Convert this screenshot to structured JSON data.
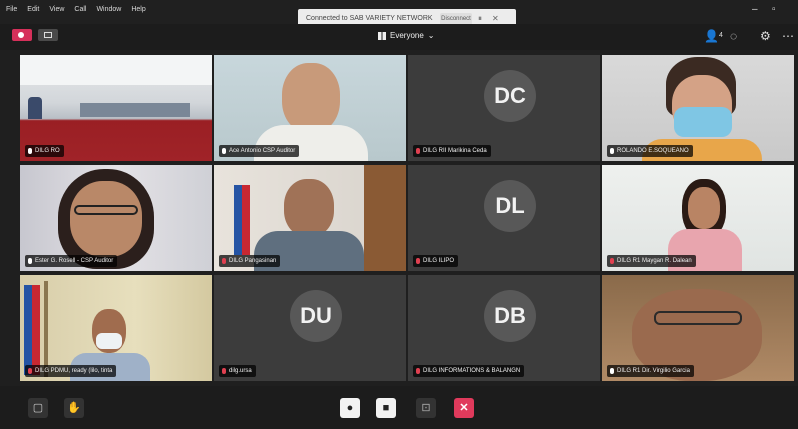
{
  "menubar": {
    "items": [
      "File",
      "Edit",
      "View",
      "Call",
      "Window",
      "Help"
    ]
  },
  "notification": {
    "text": "Connected to SAB VARIETY NETWORK",
    "button": "Disconnect"
  },
  "toolbar": {
    "view_label": "Everyone",
    "participants_count": "4"
  },
  "tiles": [
    {
      "row": 1,
      "col": 1,
      "name": "DILG RO",
      "type": "video",
      "mic": "on"
    },
    {
      "row": 1,
      "col": 2,
      "name": "Ace Antonio CSP Auditor",
      "type": "video",
      "mic": "on"
    },
    {
      "row": 1,
      "col": 3,
      "name": "DILG RII Marikina Ceda",
      "type": "avatar",
      "initials": "DC",
      "mic": "muted"
    },
    {
      "row": 1,
      "col": 4,
      "name": "ROLANDO E.SOQUEANO",
      "type": "video",
      "mic": "on"
    },
    {
      "row": 2,
      "col": 1,
      "name": "Ester G. Rosell - CSP Auditor",
      "type": "video",
      "mic": "on"
    },
    {
      "row": 2,
      "col": 2,
      "name": "DILG Pangasinan",
      "type": "video",
      "mic": "muted"
    },
    {
      "row": 2,
      "col": 3,
      "name": "DILG ILIPO",
      "type": "avatar",
      "initials": "DL",
      "mic": "muted"
    },
    {
      "row": 2,
      "col": 4,
      "name": "DILG R1 Maygan R. Dalean",
      "type": "video",
      "mic": "muted"
    },
    {
      "row": 3,
      "col": 1,
      "name": "DILG PDMU, ready (lilo, tinta",
      "type": "video",
      "mic": "muted"
    },
    {
      "row": 3,
      "col": 2,
      "name": "dilg.ursa",
      "type": "avatar",
      "initials": "DU",
      "mic": "muted"
    },
    {
      "row": 3,
      "col": 3,
      "name": "DILG INFORMATIONS & BALANGN",
      "type": "avatar",
      "initials": "DB",
      "mic": "muted"
    },
    {
      "row": 3,
      "col": 4,
      "name": "DILG R1 Dir. Virgilio Garcia",
      "type": "video",
      "mic": "on"
    }
  ],
  "bottombar": {
    "buttons": [
      "camera",
      "hand",
      "mic",
      "video",
      "share",
      "leave"
    ]
  },
  "colors": {
    "leave": "#e03a5c",
    "record": "#d6305a"
  }
}
